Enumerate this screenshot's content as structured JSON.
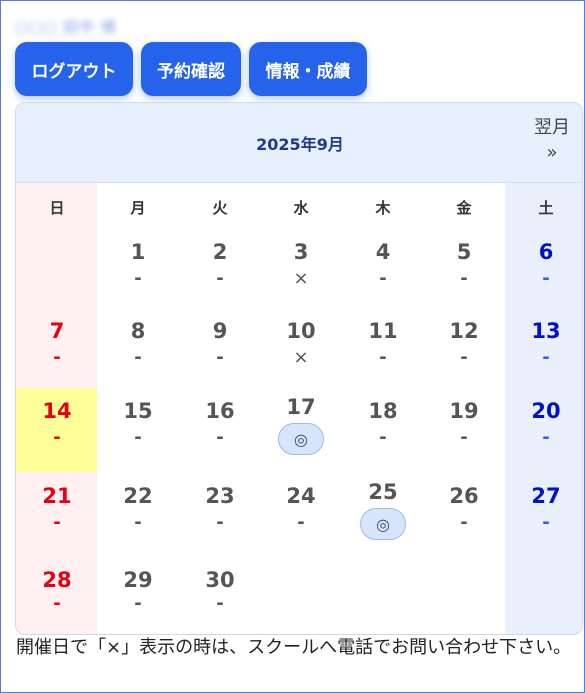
{
  "header": {
    "user_name": "○○○ 田中 様"
  },
  "buttons": {
    "logout": "ログアウト",
    "reservations": "予約確認",
    "info": "情報・成績"
  },
  "calendar": {
    "month_title": "2025年9月",
    "next_label": "翌月",
    "next_arrow": "»",
    "weekdays": [
      "日",
      "月",
      "火",
      "水",
      "木",
      "金",
      "土"
    ],
    "weeks": [
      [
        null,
        {
          "day": "1",
          "status": "-"
        },
        {
          "day": "2",
          "status": "-"
        },
        {
          "day": "3",
          "status": "×"
        },
        {
          "day": "4",
          "status": "-"
        },
        {
          "day": "5",
          "status": "-"
        },
        {
          "day": "6",
          "status": "-"
        }
      ],
      [
        {
          "day": "7",
          "status": "-"
        },
        {
          "day": "8",
          "status": "-"
        },
        {
          "day": "9",
          "status": "-"
        },
        {
          "day": "10",
          "status": "×"
        },
        {
          "day": "11",
          "status": "-"
        },
        {
          "day": "12",
          "status": "-"
        },
        {
          "day": "13",
          "status": "-"
        }
      ],
      [
        {
          "day": "14",
          "status": "-"
        },
        {
          "day": "15",
          "status": "-"
        },
        {
          "day": "16",
          "status": "-"
        },
        {
          "day": "17",
          "status": "◎"
        },
        {
          "day": "18",
          "status": "-"
        },
        {
          "day": "19",
          "status": "-"
        },
        {
          "day": "20",
          "status": "-"
        }
      ],
      [
        {
          "day": "21",
          "status": "-"
        },
        {
          "day": "22",
          "status": "-"
        },
        {
          "day": "23",
          "status": "-"
        },
        {
          "day": "24",
          "status": "-"
        },
        {
          "day": "25",
          "status": "◎"
        },
        {
          "day": "26",
          "status": "-"
        },
        {
          "day": "27",
          "status": "-"
        }
      ],
      [
        {
          "day": "28",
          "status": "-"
        },
        {
          "day": "29",
          "status": "-"
        },
        {
          "day": "30",
          "status": "-"
        },
        null,
        null,
        null,
        null
      ]
    ],
    "today": "14"
  },
  "note": "開催日で「×」表示の時は、スクールへ電話でお問い合わせ下さい。",
  "colors": {
    "button": "#2563eb",
    "sunday": "#e60012",
    "saturday": "#0012c8",
    "today": "#ffff99"
  }
}
